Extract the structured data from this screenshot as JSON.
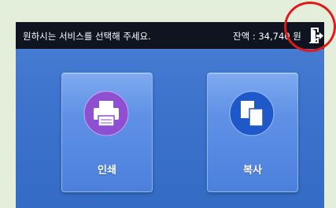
{
  "topbar": {
    "prompt": "원하시는 서비스를 선택해 주세요.",
    "balance": "잔액 : 34,740 원"
  },
  "logout": {
    "icon": "logout-icon"
  },
  "tiles": [
    {
      "label": "인쇄",
      "icon": "printer-icon"
    },
    {
      "label": "복사",
      "icon": "copy-icon"
    }
  ],
  "colors": {
    "panel": "#3d73cc",
    "topbar": "#0f1420",
    "highlight": "#e01a1a",
    "print_icon": "#8e4fd0",
    "copy_icon": "#1f58c8"
  }
}
